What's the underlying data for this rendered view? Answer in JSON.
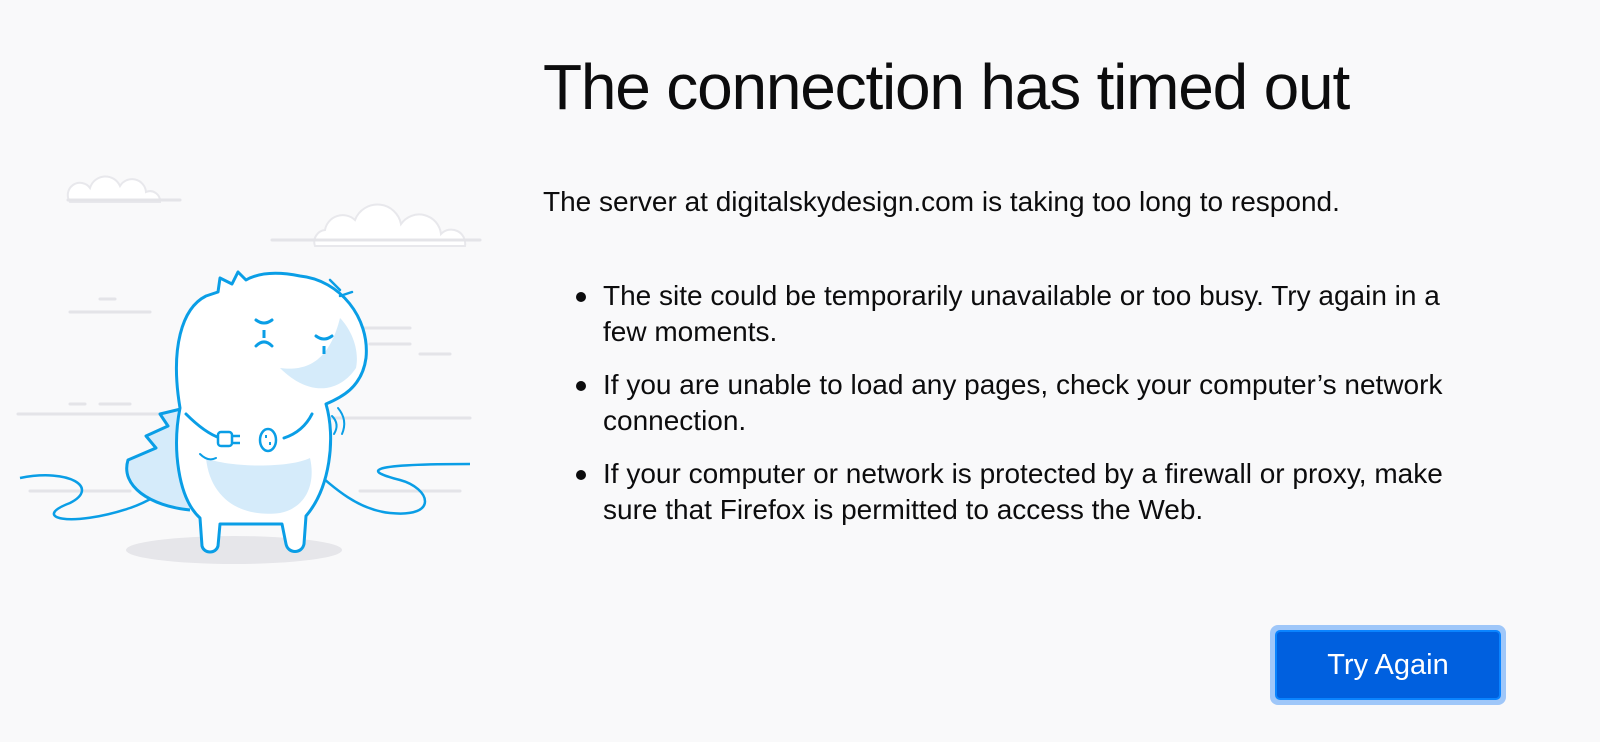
{
  "error_page": {
    "title": "The connection has timed out",
    "description": "The server at digitalskydesign.com is taking too long to respond.",
    "reasons": [
      "The site could be temporarily unavailable or too busy. Try again in a few moments.",
      "If you are unable to load any pages, check your computer’s network connection.",
      "If your computer or network is protected by a firewall or proxy, make sure that Firefox is permitted to access the Web."
    ],
    "try_again_label": "Try Again",
    "illustration": "unplugged-dinosaur-illustration"
  },
  "colors": {
    "background": "#f9f9fa",
    "text": "#0c0c0d",
    "button": "#0060df",
    "button_focus_ring": "#9fc7f9",
    "illustration_stroke": "#0a9ee6",
    "illustration_fill": "#d5ebfa"
  }
}
